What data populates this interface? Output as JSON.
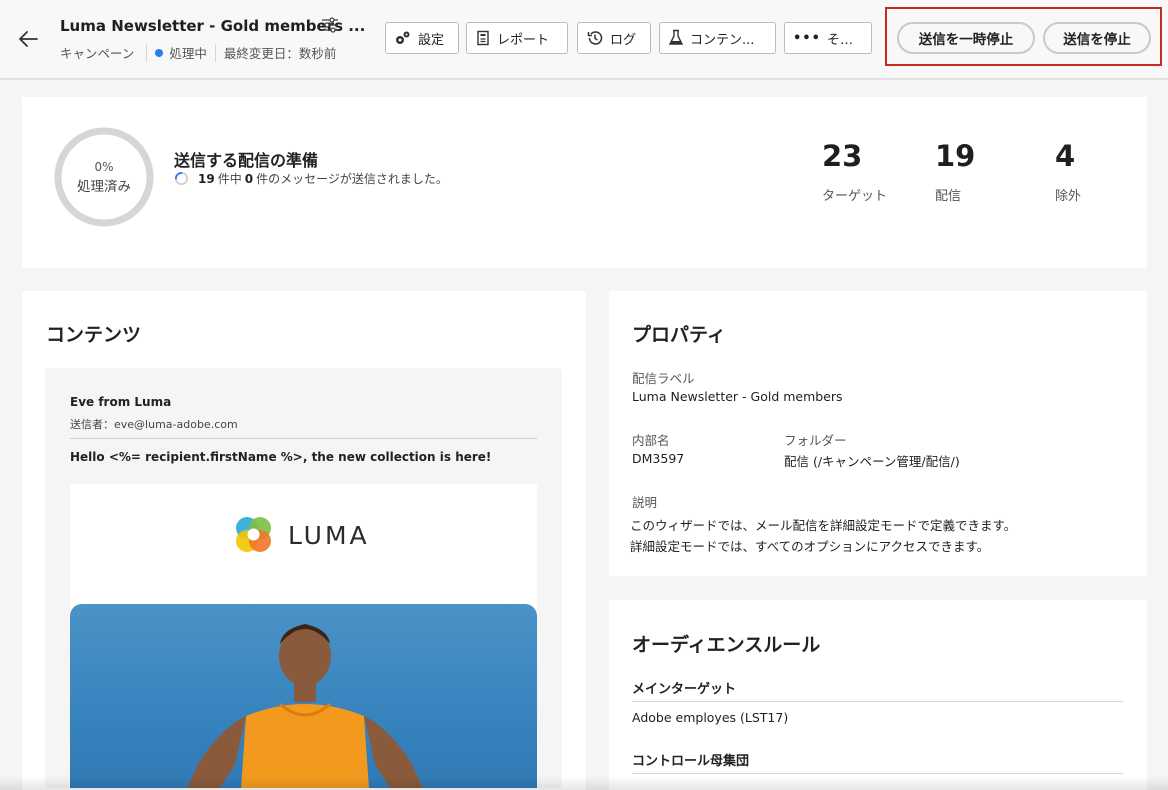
{
  "header": {
    "title": "Luma Newsletter - Gold members ...",
    "subtitle": {
      "type": "キャンペーン",
      "status": "処理中",
      "last_modified": "最終変更日：数秒前"
    },
    "toolbar": {
      "settings": "設定",
      "report": "レポート",
      "logs": "ログ",
      "content": "コンテン...",
      "more": "その他"
    },
    "actions": {
      "pause": "送信を一時停止",
      "stop": "送信を停止"
    },
    "colors": {
      "accent_red": "#c52a22",
      "status_blue": "#2680eb"
    }
  },
  "summary": {
    "percent": "0%",
    "processed_label": "処理済み",
    "title": "送信する配信の準備",
    "message": {
      "count_total": "19",
      "mid": "件中",
      "count_sent": "0",
      "suffix": "件のメッセージが送信されました。"
    },
    "stats": [
      {
        "value": "23",
        "label": "ターゲット"
      },
      {
        "value": "19",
        "label": "配信"
      },
      {
        "value": "4",
        "label": "除外"
      }
    ]
  },
  "content": {
    "title": "コンテンツ",
    "email": {
      "from_name": "Eve from Luma",
      "sender": "送信者：eve@luma-adobe.com",
      "subject": "Hello <%= recipient.firstName %>, the new collection is here!",
      "logo_text": "LUMA"
    }
  },
  "properties": {
    "title": "プロパティ",
    "label_label": "配信ラベル",
    "label_value": "Luma Newsletter - Gold members",
    "internal_name_label": "内部名",
    "internal_name_value": "DM3597",
    "folder_label": "フォルダー",
    "folder_value": "配信 (/キャンペーン管理/配信/)",
    "description_label": "説明",
    "description_line1": "このウィザードでは、メール配信を詳細設定モードで定義できます。",
    "description_line2": "詳細設定モードでは、すべてのオプションにアクセスできます。"
  },
  "audience": {
    "title": "オーディエンスルール",
    "main_target_label": "メインターゲット",
    "main_target_value": "Adobe employes (LST17)",
    "control_group_label": "コントロール母集団"
  }
}
